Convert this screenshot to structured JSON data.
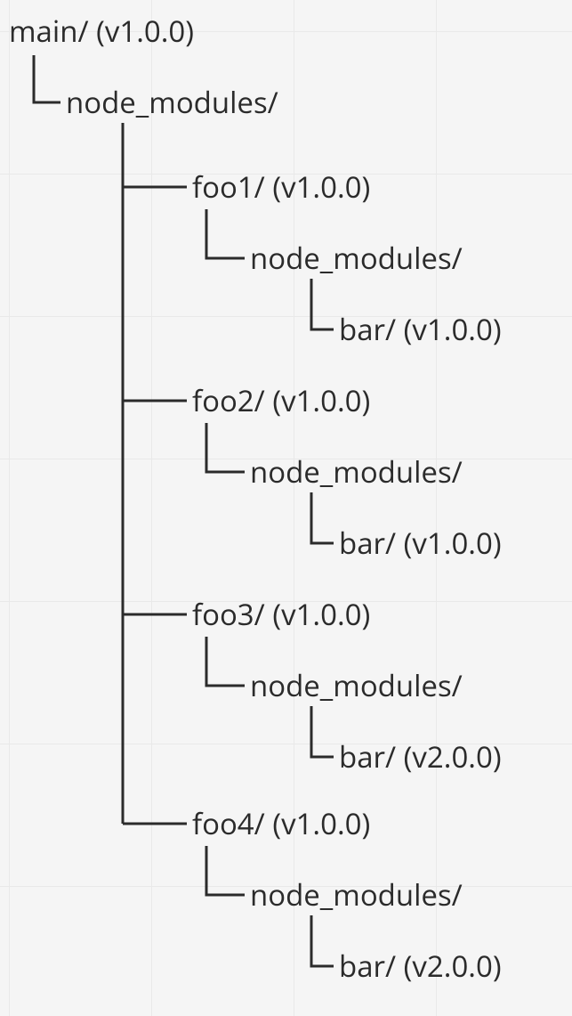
{
  "tree": {
    "root": {
      "label": "main/ (v1.0.0)"
    },
    "root_child": {
      "label": "node_modules/"
    },
    "packages": [
      {
        "name": "foo1/ (v1.0.0)",
        "child": {
          "label": "node_modules/"
        },
        "grandchild": {
          "label": "bar/ (v1.0.0)"
        }
      },
      {
        "name": "foo2/ (v1.0.0)",
        "child": {
          "label": "node_modules/"
        },
        "grandchild": {
          "label": "bar/ (v1.0.0)"
        }
      },
      {
        "name": "foo3/ (v1.0.0)",
        "child": {
          "label": "node_modules/"
        },
        "grandchild": {
          "label": "bar/ (v2.0.0)"
        }
      },
      {
        "name": "foo4/ (v1.0.0)",
        "child": {
          "label": "node_modules/"
        },
        "grandchild": {
          "label": "bar/ (v2.0.0)"
        }
      }
    ]
  }
}
